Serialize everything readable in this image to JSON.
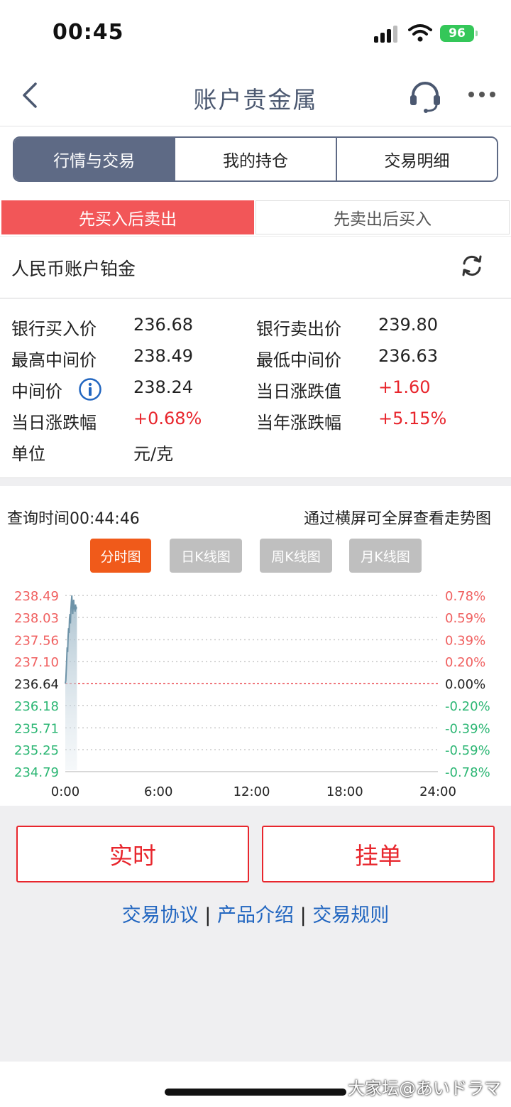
{
  "status_bar": {
    "time": "00:45",
    "battery": "96"
  },
  "nav": {
    "title": "账户贵金属"
  },
  "segments": [
    "行情与交易",
    "我的持仓",
    "交易明细"
  ],
  "direction_tabs": [
    "先买入后卖出",
    "先卖出后买入"
  ],
  "product": {
    "name": "人民币账户铂金"
  },
  "prices": {
    "bank_buy_label": "银行买入价",
    "bank_buy": "236.68",
    "bank_sell_label": "银行卖出价",
    "bank_sell": "239.80",
    "high_mid_label": "最高中间价",
    "high_mid": "238.49",
    "low_mid_label": "最低中间价",
    "low_mid": "236.63",
    "mid_label": "中间价",
    "mid": "238.24",
    "day_change_label": "当日涨跌值",
    "day_change": "+1.60",
    "day_pct_label": "当日涨跌幅",
    "day_pct": "+0.68%",
    "year_pct_label": "当年涨跌幅",
    "year_pct": "+5.15%",
    "unit_label": "单位",
    "unit": "元/克"
  },
  "chart_header": {
    "query_time": "查询时间00:44:46",
    "hint": "通过横屏可全屏查看走势图"
  },
  "chart_tabs": [
    "分时图",
    "日K线图",
    "周K线图",
    "月K线图"
  ],
  "chart_data": {
    "type": "area",
    "baseline": 236.64,
    "ylim": [
      234.79,
      238.49
    ],
    "y_ticks": [
      "238.49",
      "238.03",
      "237.56",
      "237.10",
      "236.64",
      "236.18",
      "235.71",
      "235.25",
      "234.79"
    ],
    "pct_ticks": [
      "0.78%",
      "0.59%",
      "0.39%",
      "0.20%",
      "0.00%",
      "-0.20%",
      "-0.39%",
      "-0.59%",
      "-0.78%"
    ],
    "x_ticks": [
      "0:00",
      "6:00",
      "12:00",
      "18:00",
      "24:00"
    ],
    "x_range_hours": [
      0,
      24
    ],
    "x": [
      0.0,
      0.03,
      0.06,
      0.09,
      0.12,
      0.15,
      0.18,
      0.21,
      0.24,
      0.27,
      0.3,
      0.33,
      0.36,
      0.39,
      0.42,
      0.45,
      0.48,
      0.51,
      0.54,
      0.57,
      0.6,
      0.63,
      0.66,
      0.69,
      0.72,
      0.75
    ],
    "values": [
      236.64,
      236.7,
      236.9,
      237.15,
      237.4,
      237.3,
      237.6,
      237.8,
      237.7,
      238.0,
      238.1,
      237.9,
      238.2,
      238.35,
      238.49,
      238.3,
      238.1,
      238.3,
      238.4,
      238.2,
      238.25,
      238.15,
      238.3,
      238.2,
      238.24,
      238.24
    ],
    "colors": {
      "up": "#f06060",
      "down": "#2bb673",
      "line": "#6e93a8",
      "baseline": "#e8262d"
    }
  },
  "actions": {
    "realtime": "实时",
    "order": "挂单"
  },
  "links": [
    "交易协议",
    "产品介绍",
    "交易规则"
  ],
  "link_separator": "|",
  "watermark": "大家坛@あいドラマ"
}
